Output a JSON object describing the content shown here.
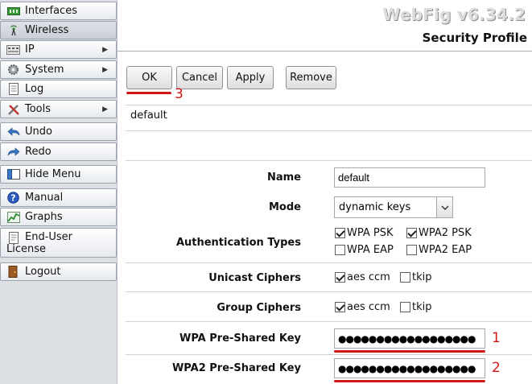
{
  "sidebar": {
    "items": [
      {
        "label": "Interfaces",
        "icon": "interfaces-icon"
      },
      {
        "label": "Wireless",
        "icon": "wireless-icon"
      },
      {
        "label": "IP",
        "icon": "ip-icon"
      },
      {
        "label": "System",
        "icon": "gear-icon"
      },
      {
        "label": "Log",
        "icon": "log-icon"
      },
      {
        "label": "Tools",
        "icon": "tools-icon"
      },
      {
        "label": "Undo",
        "icon": "undo-icon"
      },
      {
        "label": "Redo",
        "icon": "redo-icon"
      },
      {
        "label": "Hide Menu",
        "icon": "hide-menu-icon"
      },
      {
        "label": "Manual",
        "icon": "help-icon"
      },
      {
        "label": "Graphs",
        "icon": "graphs-icon"
      },
      {
        "label_line1": "End-User",
        "label_line2": "License",
        "icon": "license-icon"
      },
      {
        "label": "Logout",
        "icon": "logout-icon"
      }
    ]
  },
  "header": {
    "brand": "WebFig v6.34.2",
    "title": "Security Profile"
  },
  "toolbar": {
    "ok_label": "OK",
    "cancel_label": "Cancel",
    "apply_label": "Apply",
    "remove_label": "Remove"
  },
  "annotations": {
    "n1": "1",
    "n2": "2",
    "n3": "3",
    "color": "#d01818"
  },
  "profile_name_display": "default",
  "form": {
    "name_label": "Name",
    "name_value": "default",
    "mode_label": "Mode",
    "mode_value": "dynamic keys",
    "auth_label": "Authentication Types",
    "auth_options": [
      {
        "label": "WPA PSK",
        "checked": true
      },
      {
        "label": "WPA2 PSK",
        "checked": true
      },
      {
        "label": "WPA EAP",
        "checked": false
      },
      {
        "label": "WPA2 EAP",
        "checked": false
      }
    ],
    "unicast_label": "Unicast Ciphers",
    "unicast_options": [
      {
        "label": "aes ccm",
        "checked": true
      },
      {
        "label": "tkip",
        "checked": false
      }
    ],
    "group_label": "Group Ciphers",
    "group_options": [
      {
        "label": "aes ccm",
        "checked": true
      },
      {
        "label": "tkip",
        "checked": false
      }
    ],
    "wpa_psk_label": "WPA Pre-Shared Key",
    "wpa_psk_value": "●●●●●●●●●●●●●●●●●●",
    "wpa2_psk_label": "WPA2 Pre-Shared Key",
    "wpa2_psk_value": "●●●●●●●●●●●●●●●●●●"
  }
}
